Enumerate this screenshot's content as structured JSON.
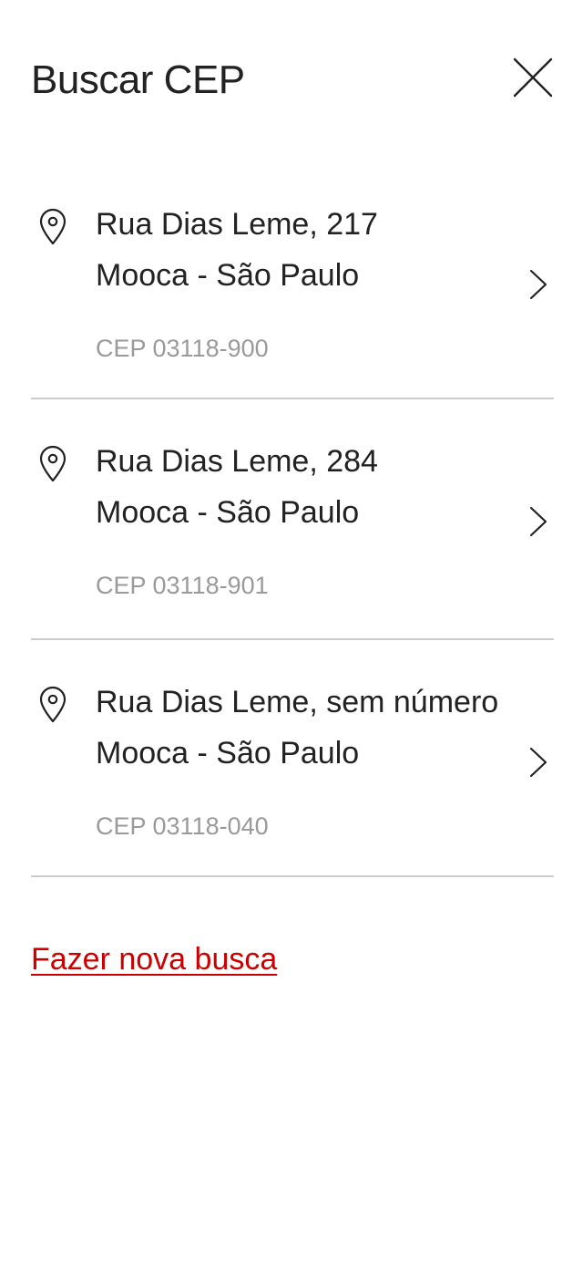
{
  "header": {
    "title": "Buscar CEP",
    "close_icon": "close-icon"
  },
  "results": [
    {
      "street": "Rua Dias Leme, 217",
      "district_city": "Mooca - São Paulo",
      "cep": "CEP 03118-900"
    },
    {
      "street": "Rua Dias Leme, 284",
      "district_city": "Mooca - São Paulo",
      "cep": "CEP 03118-901"
    },
    {
      "street": "Rua Dias Leme, sem número",
      "district_city": "Mooca - São Paulo",
      "cep": "CEP 03118-040"
    }
  ],
  "new_search_link": "Fazer nova busca",
  "colors": {
    "accent": "#cc0000",
    "text": "#222222",
    "muted": "#9a9a9a",
    "divider": "#cccccc",
    "background": "#ffffff"
  },
  "icons": {
    "item_leading": "map-pin-icon",
    "item_trailing": "chevron-right-icon"
  }
}
